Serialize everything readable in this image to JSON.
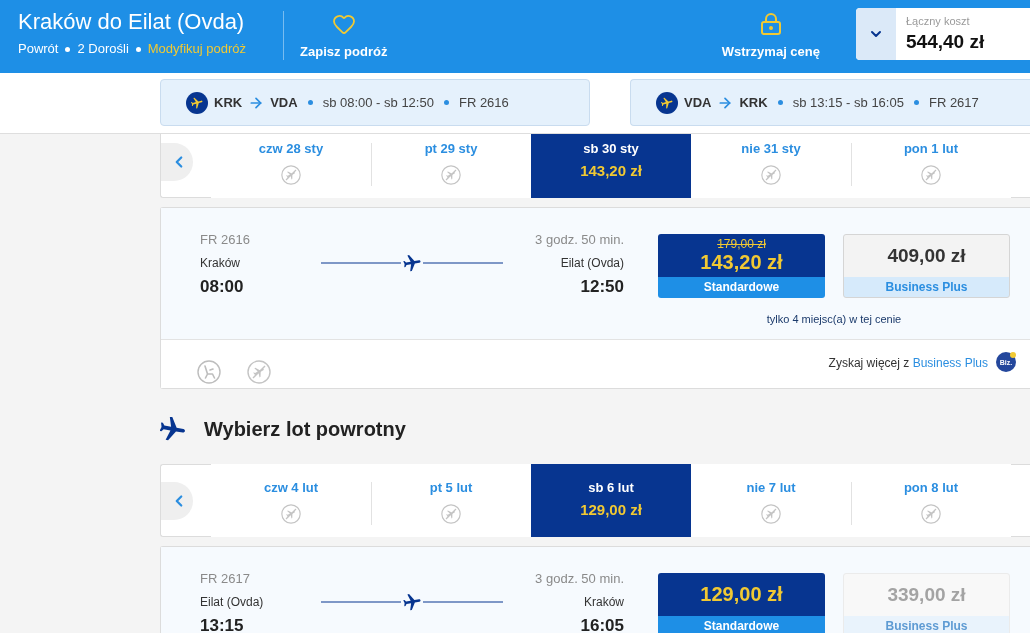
{
  "header": {
    "title": "Kraków do Eilat (Ovda)",
    "trip_type": "Powrót",
    "passengers": "2 Dorośli",
    "modify_link": "Modyfikuj podróż",
    "save_button": "Zapisz podróż",
    "hold_button": "Wstrzymaj cenę",
    "total": {
      "label": "Łączny koszt",
      "value": "544,40 zł"
    }
  },
  "flight_tabs": [
    {
      "from": "KRK",
      "to": "VDA",
      "times": "sb 08:00 - sb 12:50",
      "flight_number": "FR 2616"
    },
    {
      "from": "VDA",
      "to": "KRK",
      "times": "sb 13:15 - sb 16:05",
      "flight_number": "FR 2617"
    }
  ],
  "journeys": [
    {
      "dates": [
        {
          "label": "czw 28 sty",
          "selected": false
        },
        {
          "label": "pt 29 sty",
          "selected": false
        },
        {
          "label": "sb 30 sty",
          "selected": true,
          "price": "143,20 zł"
        },
        {
          "label": "nie 31 sty",
          "selected": false
        },
        {
          "label": "pon 1 lut",
          "selected": false
        }
      ],
      "flight": {
        "number": "FR 2616",
        "duration": "3 godz. 50 min.",
        "from_city": "Kraków",
        "to_city": "Eilat (Ovda)",
        "departure": "08:00",
        "arrival": "12:50",
        "fares": [
          {
            "old_price": "179,00 zł",
            "price": "143,20 zł",
            "name": "Standardowe",
            "selected": true,
            "disabled": false
          },
          {
            "price": "409,00 zł",
            "name": "Business Plus",
            "selected": false,
            "disabled": false
          }
        ],
        "seats_note": "tylko 4 miejsc(a) w tej cenie",
        "upsell": {
          "text": "Zyskaj więcej z",
          "link": "Business Plus",
          "badge": "Biz."
        }
      }
    },
    {
      "heading": "Wybierz lot powrotny",
      "dates": [
        {
          "label": "czw 4 lut",
          "selected": false
        },
        {
          "label": "pt 5 lut",
          "selected": false
        },
        {
          "label": "sb 6 lut",
          "selected": true,
          "price": "129,00 zł"
        },
        {
          "label": "nie 7 lut",
          "selected": false
        },
        {
          "label": "pon 8 lut",
          "selected": false
        }
      ],
      "flight": {
        "number": "FR 2617",
        "duration": "3 godz. 50 min.",
        "from_city": "Eilat (Ovda)",
        "to_city": "Kraków",
        "departure": "13:15",
        "arrival": "16:05",
        "fares": [
          {
            "price": "129,00 zł",
            "name": "Standardowe",
            "selected": true,
            "disabled": false
          },
          {
            "price": "339,00 zł",
            "name": "Business Plus",
            "selected": false,
            "disabled": true
          }
        ]
      }
    }
  ]
}
